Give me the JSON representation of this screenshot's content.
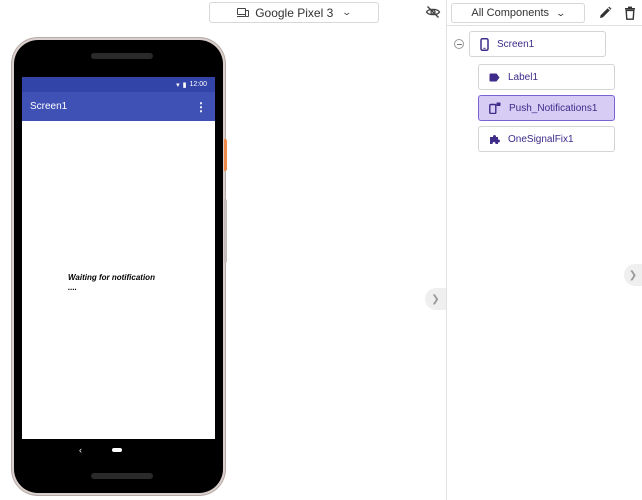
{
  "viewer": {
    "device_selector": {
      "label": "Google Pixel 3"
    },
    "phone": {
      "status_time": "12:00",
      "screen_title": "Screen1",
      "label1_text": "Waiting for notification\n....",
      "nav_back_glyph": "‹"
    }
  },
  "components_panel": {
    "filter": {
      "label": "All Components"
    },
    "tree": [
      {
        "name": "Screen1",
        "icon": "phone-screen-icon",
        "selected": false
      },
      {
        "name": "Label1",
        "icon": "label-tag-icon",
        "selected": false
      },
      {
        "name": "Push_Notifications1",
        "icon": "push-notification-icon",
        "selected": true
      },
      {
        "name": "OneSignalFix1",
        "icon": "puzzle-extension-icon",
        "selected": false
      }
    ]
  },
  "colors": {
    "app_bar": "#3f51b5",
    "status_bar": "#3344a8",
    "selected_node_bg": "#d6ccf4",
    "node_text": "#3e2b8a"
  },
  "icons": {
    "device": "device-icon",
    "visibility": "eye-off-icon",
    "edit": "pencil-icon",
    "delete": "trash-icon",
    "collapse": "chevron-right-icon"
  }
}
